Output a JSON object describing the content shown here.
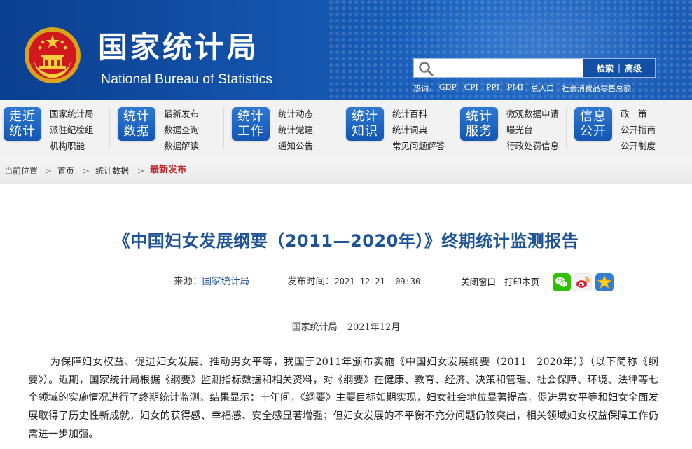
{
  "header": {
    "title_cn": "国家统计局",
    "title_en": "National Bureau of Statistics",
    "search": {
      "placeholder": "",
      "search_label": "检索",
      "separator": "|",
      "advanced_label": "高级"
    },
    "hotwords_label": "热词:",
    "hotwords": [
      "GDP",
      "CPI",
      "PPI",
      "PMI",
      "总人口",
      "社会消费品零售总额"
    ]
  },
  "nav": {
    "groups": [
      {
        "badge": [
          "走近",
          "统计"
        ],
        "links": [
          "国家统计局",
          "派驻纪检组",
          "机构职能"
        ]
      },
      {
        "badge": [
          "统计",
          "数据"
        ],
        "links": [
          "最新发布",
          "数据查询",
          "数据解读"
        ]
      },
      {
        "badge": [
          "统计",
          "工作"
        ],
        "links": [
          "统计动态",
          "统计党建",
          "通知公告"
        ]
      },
      {
        "badge": [
          "统计",
          "知识"
        ],
        "links": [
          "统计百科",
          "统计词典",
          "常见问题解答"
        ]
      },
      {
        "badge": [
          "统计",
          "服务"
        ],
        "links": [
          "微观数据申请",
          "曝光台",
          "行政处罚信息"
        ]
      },
      {
        "badge": [
          "信息",
          "公开"
        ],
        "links": [
          "政　策",
          "公开指南",
          "公开制度"
        ]
      }
    ]
  },
  "breadcrumb": {
    "items": [
      "当前位置",
      "首页",
      "统计数据",
      "最新发布"
    ],
    "separator": ">"
  },
  "article": {
    "title": "《中国妇女发展纲要（2011—2020年）》终期统计监测报告",
    "source_label": "来源：",
    "source_value": "国家统计局",
    "time_label": "发布时间：",
    "time_value": "2021-12-21  09:30",
    "close_window": "关闭窗口",
    "print_page": "打印本页",
    "byline_org": "国家统计局",
    "byline_date": "2021年12月",
    "paragraph": "为保障妇女权益、促进妇女发展、推动男女平等，我国于2011年颁布实施《中国妇女发展纲要（2011－2020年）》（以下简称《纲要》）。近期，国家统计局根据《纲要》监测指标数据和相关资料，对《纲要》在健康、教育、经济、决策和管理、社会保障、环境、法律等七个领域的实施情况进行了终期统计监测。结果显示：十年间，《纲要》主要目标如期实现，妇女社会地位显著提高，促进男女平等和妇女全面发展取得了历史性新成就，妇女的获得感、幸福感、安全感显著增强；但妇女发展的不平衡不充分问题仍较突出，相关领域妇女权益保障工作仍需进一步加强。"
  },
  "share_icons": [
    "wechat-icon",
    "weibo-icon",
    "favorite-star-icon"
  ],
  "colors": {
    "banner_blue": "#1556b0",
    "title_blue": "#1e5497",
    "breadcrumb_active": "#c0282c",
    "badge_blue": "#1356b3"
  }
}
